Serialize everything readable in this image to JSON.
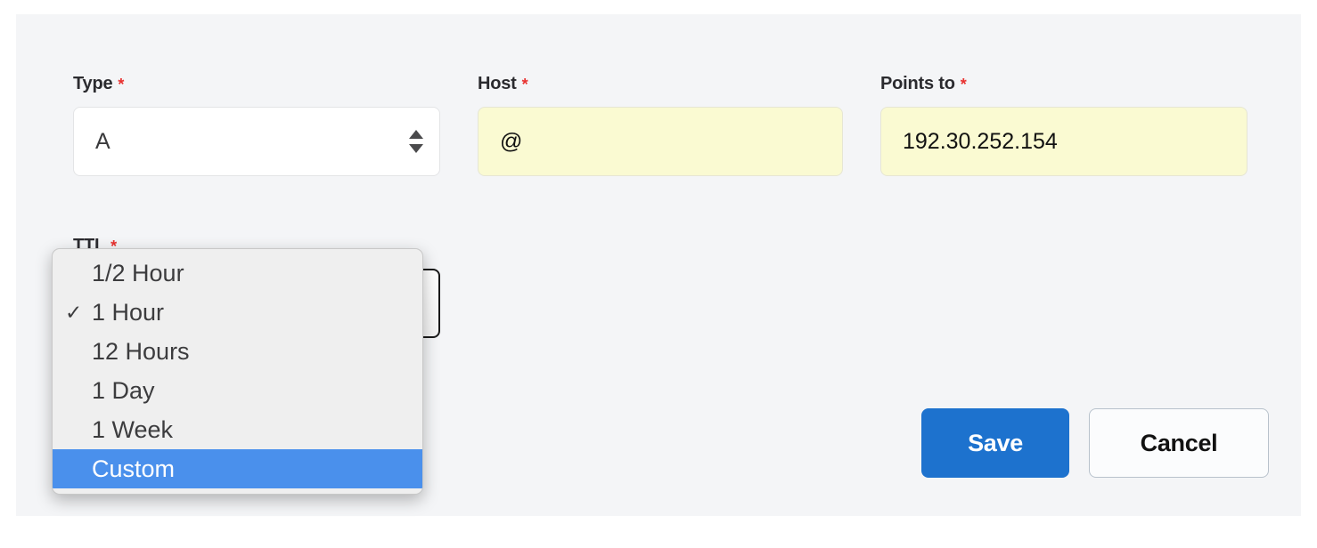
{
  "form": {
    "required_marker": "*",
    "fields": [
      {
        "key": "type",
        "label": "Type",
        "required": true,
        "control": "select",
        "value": "A",
        "autofilled": false
      },
      {
        "key": "host",
        "label": "Host",
        "required": true,
        "control": "text",
        "value": "@",
        "autofilled": true
      },
      {
        "key": "points_to",
        "label": "Points to",
        "required": true,
        "control": "text",
        "value": "192.30.252.154",
        "autofilled": true
      },
      {
        "key": "ttl",
        "label": "TTL",
        "required": true,
        "control": "select",
        "value": "1 Hour",
        "autofilled": false,
        "expanded": true
      }
    ]
  },
  "ttl_dropdown": {
    "open": true,
    "checked_value": "1 Hour",
    "highlighted_value": "Custom",
    "check_glyph": "✓",
    "options": [
      {
        "label": "1/2 Hour",
        "checked": false,
        "highlighted": false
      },
      {
        "label": "1 Hour",
        "checked": true,
        "highlighted": false
      },
      {
        "label": "12 Hours",
        "checked": false,
        "highlighted": false
      },
      {
        "label": "1 Day",
        "checked": false,
        "highlighted": false
      },
      {
        "label": "1 Week",
        "checked": false,
        "highlighted": false
      },
      {
        "label": "Custom",
        "checked": false,
        "highlighted": true
      }
    ]
  },
  "actions": {
    "save_label": "Save",
    "cancel_label": "Cancel"
  },
  "colors": {
    "panel_background": "#f4f5f7",
    "page_background": "#ffffff",
    "required_asterisk": "#e8312f",
    "label_text": "#2b2b2f",
    "autofill_background": "#fafad2",
    "dropdown_background": "#efefef",
    "dropdown_highlight": "#4a90ec",
    "primary_button": "#1d72ce",
    "secondary_button_border": "#b8c2cc"
  }
}
